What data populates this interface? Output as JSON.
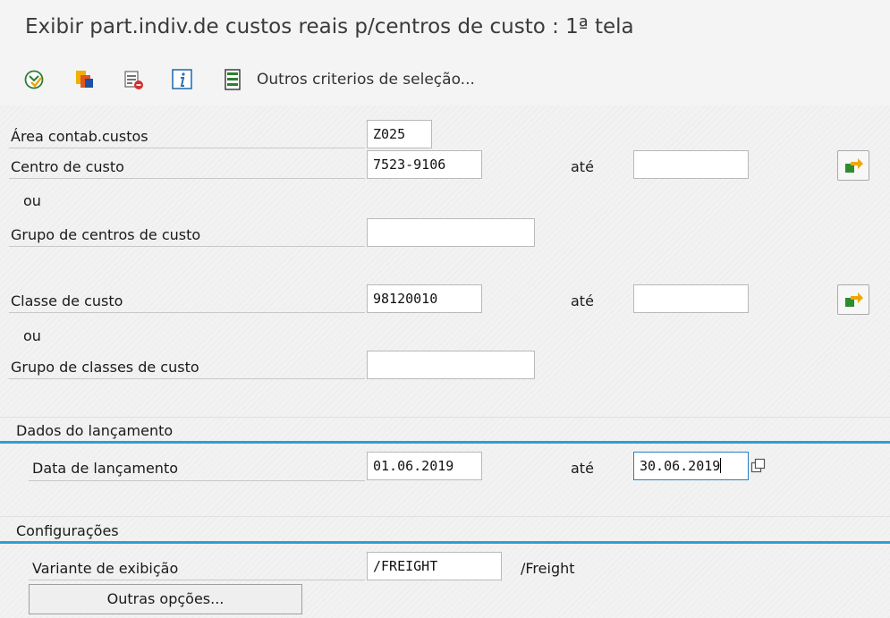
{
  "title": "Exibir part.indiv.de custos reais p/centros de custo : 1ª tela",
  "toolbar": {
    "icons": [
      "execute-icon",
      "copy-selection-icon",
      "delete-selection-icon",
      "info-icon",
      "other-criteria-icon"
    ],
    "other_criteria_label": "Outros criterios de seleção..."
  },
  "form": {
    "area": {
      "label": "Área contab.custos",
      "value": "Z025"
    },
    "cost_center": {
      "label": "Centro de custo",
      "value": "7523-9106",
      "to_label": "até",
      "to_value": ""
    },
    "or1": "ou",
    "cost_center_group": {
      "label": "Grupo de centros de custo",
      "value": ""
    },
    "cost_element": {
      "label": "Classe de custo",
      "value": "98120010",
      "to_label": "até",
      "to_value": ""
    },
    "or2": "ou",
    "cost_element_group": {
      "label": "Grupo de classes de custo",
      "value": ""
    }
  },
  "posting": {
    "section_title": "Dados do lançamento",
    "date": {
      "label": "Data de lançamento",
      "value": "01.06.2019",
      "to_label": "até",
      "to_value": "30.06.2019"
    }
  },
  "settings": {
    "section_title": "Configurações",
    "layout": {
      "label": "Variante de exibição",
      "value": "/FREIGHT",
      "description": "/Freight"
    },
    "more_button": "Outras opções..."
  },
  "colors": {
    "accent_line": "#2ba0d6",
    "focus_border": "#2a7fc0"
  }
}
